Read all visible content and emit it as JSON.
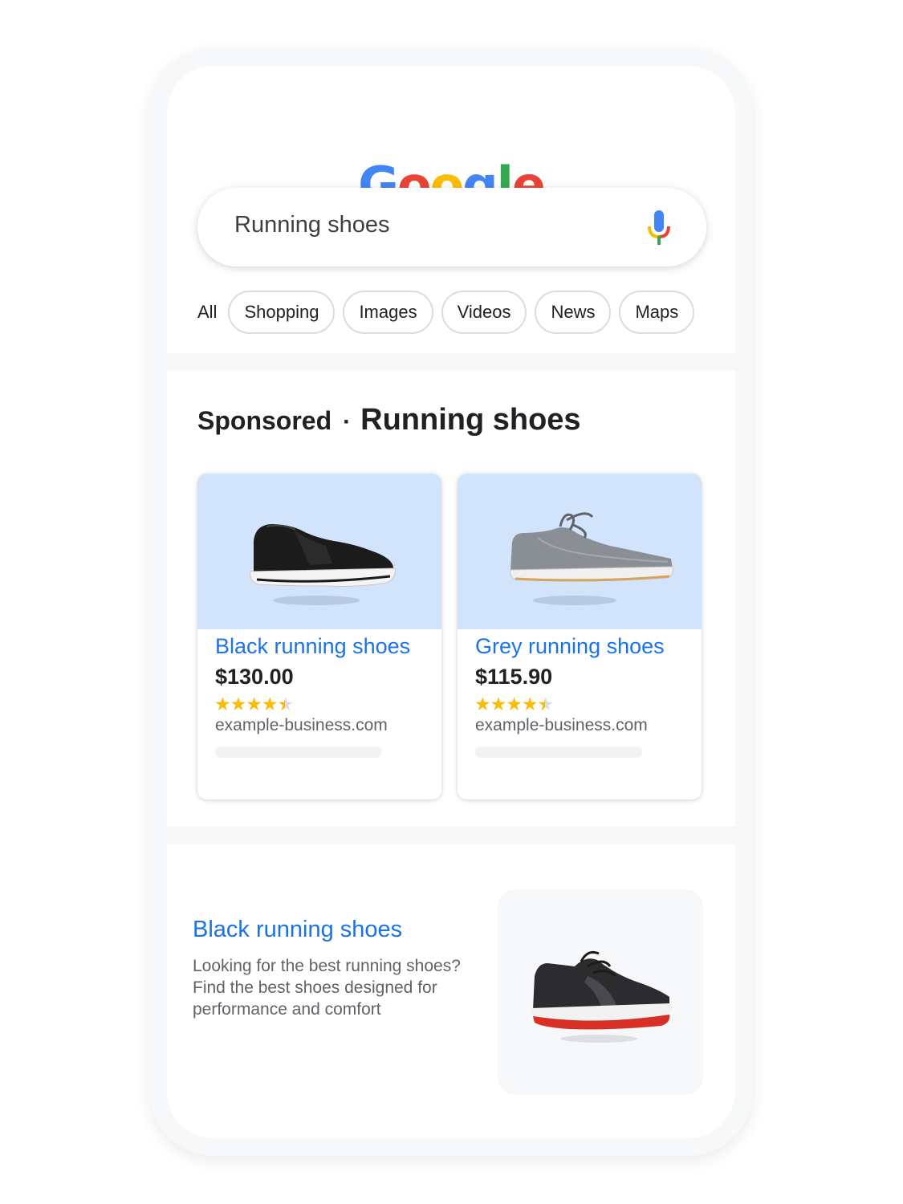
{
  "logo": {
    "letters": [
      "G",
      "o",
      "o",
      "g",
      "l",
      "e"
    ],
    "colors": [
      "#4285F4",
      "#EA4335",
      "#FBBC05",
      "#4285F4",
      "#34A853",
      "#EA4335"
    ]
  },
  "search": {
    "query": "Running shoes",
    "mic_icon": "mic-icon"
  },
  "tabs": {
    "all": "All",
    "chips": [
      "Shopping",
      "Images",
      "Videos",
      "News",
      "Maps"
    ]
  },
  "sponsored": {
    "label": "Sponsored",
    "separator": "·",
    "title": "Running shoes"
  },
  "products": [
    {
      "title": "Black running shoes",
      "price": "$130.00",
      "rating": 4.5,
      "domain": "example-business.com",
      "image_icon": "black-slip-on-shoe-image"
    },
    {
      "title": "Grey running shoes",
      "price": "$115.90",
      "rating": 4.5,
      "domain": "example-business.com",
      "image_icon": "grey-lace-up-shoe-image"
    }
  ],
  "text_ad": {
    "title": "Black running shoes",
    "description": "Looking for the best running shoes? Find the best shoes designed for performance and comfort",
    "image_icon": "black-red-running-shoe-image"
  },
  "colors": {
    "link": "#1a73e8",
    "star": "#fbbc04",
    "product_bg": "#d2e3fc",
    "divider": "#f6f8fa"
  }
}
